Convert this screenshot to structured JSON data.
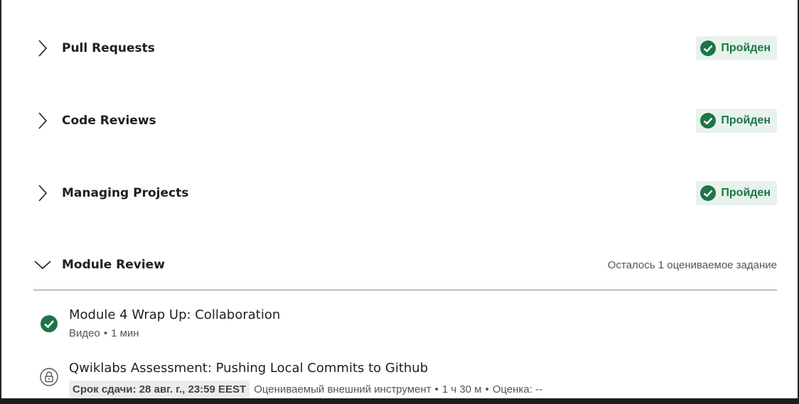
{
  "sections": [
    {
      "title": "Pull Requests",
      "status": "Пройден"
    },
    {
      "title": "Code Reviews",
      "status": "Пройден"
    },
    {
      "title": "Managing Projects",
      "status": "Пройден"
    }
  ],
  "module_review": {
    "title": "Module Review",
    "remaining": "Осталось 1 оцениваемое задание",
    "items": [
      {
        "title": "Module 4 Wrap Up: Collaboration",
        "type": "Видео",
        "duration": "1 мин",
        "icon": "check-circle-icon"
      },
      {
        "title": "Qwiklabs Assessment: Pushing Local Commits to Github",
        "due": "Срок сдачи: 28 авг. г., 23:59 EEST",
        "type": "Оцениваемый внешний инструмент",
        "duration": "1 ч 30 м",
        "grade": "Оценка: --",
        "icon": "lock-icon"
      }
    ]
  },
  "colors": {
    "success_green": "#1e7547",
    "badge_bg": "#e7f2ec",
    "divider": "#8f8f8f"
  }
}
